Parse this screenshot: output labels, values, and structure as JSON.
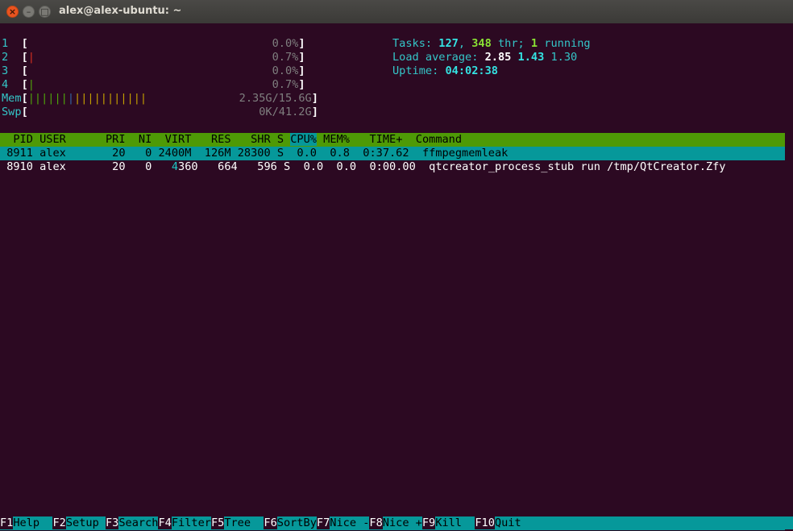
{
  "window": {
    "title": "alex@alex-ubuntu: ~"
  },
  "meters": {
    "cpus": [
      {
        "label": "1",
        "bar": "",
        "bar_color": "",
        "value": "0.0%"
      },
      {
        "label": "2",
        "bar": "|",
        "bar_color": "red",
        "value": "0.7%"
      },
      {
        "label": "3",
        "bar": "",
        "bar_color": "",
        "value": "0.0%"
      },
      {
        "label": "4",
        "bar": "|",
        "bar_color": "green",
        "value": "0.7%"
      }
    ],
    "mem": {
      "label": "Mem",
      "bar_green": "||||||",
      "bar_blue": "|",
      "bar_yellow": "|||||||||||",
      "value": "2.35G/15.6G"
    },
    "swp": {
      "label": "Swp",
      "value": "0K/41.2G"
    }
  },
  "stats": {
    "tasks_label": "Tasks: ",
    "tasks": "127",
    "sep": ", ",
    "threads": "348",
    "thr_label": " thr; ",
    "running": "1",
    "running_label": " running",
    "load_label": "Load average: ",
    "load1": "2.85",
    "load5": "1.43",
    "load15": "1.30",
    "uptime_label": "Uptime: ",
    "uptime": "04:02:38"
  },
  "table": {
    "headers": {
      "pid": "  PID",
      "user": "USER",
      "pri": "PRI",
      "ni": "NI",
      "virt": "VIRT",
      "res": "RES",
      "shr": "SHR",
      "s": "S",
      "cpu": "CPU%",
      "mem": "MEM%",
      "time": "TIME+",
      "command": "Command"
    },
    "rows": [
      {
        "pid": "8911",
        "user": "alex",
        "pri": "20",
        "ni": "0",
        "virt": "2400M",
        "virt_lead": "",
        "res": "126M",
        "shr": "28300",
        "s": "S",
        "cpu": "0.0",
        "mem": "0.8",
        "time": "0:37.62",
        "command": "ffmpegmemleak"
      },
      {
        "pid": "8910",
        "user": "alex",
        "pri": "20",
        "ni": "0",
        "virt": "360",
        "virt_lead": "4",
        "res": "664",
        "shr": "596",
        "s": "S",
        "cpu": "0.0",
        "mem": "0.0",
        "time": "0:00.00",
        "command": "qtcreator_process_stub run /tmp/QtCreator.Zfy"
      }
    ]
  },
  "footer": [
    {
      "key": "F1",
      "label": "Help  "
    },
    {
      "key": "F2",
      "label": "Setup "
    },
    {
      "key": "F3",
      "label": "Search"
    },
    {
      "key": "F4",
      "label": "Filter"
    },
    {
      "key": "F5",
      "label": "Tree  "
    },
    {
      "key": "F6",
      "label": "SortBy"
    },
    {
      "key": "F7",
      "label": "Nice -"
    },
    {
      "key": "F8",
      "label": "Nice +"
    },
    {
      "key": "F9",
      "label": "Kill  "
    },
    {
      "key": "F10",
      "label": "Quit                                              "
    }
  ]
}
